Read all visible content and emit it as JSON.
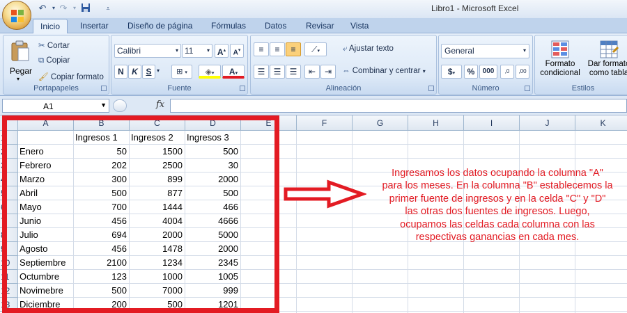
{
  "window": {
    "title": "Libro1 - Microsoft Excel"
  },
  "quick_access": {
    "undo_icon": "undo-icon",
    "redo_icon": "redo-icon",
    "save_icon": "save-icon"
  },
  "tabs": [
    "Inicio",
    "Insertar",
    "Diseño de página",
    "Fórmulas",
    "Datos",
    "Revisar",
    "Vista"
  ],
  "ribbon": {
    "portapapeles": {
      "label": "Portapapeles",
      "pegar": "Pegar",
      "cortar": "Cortar",
      "copiar": "Copiar",
      "copiar_formato": "Copiar formato"
    },
    "fuente": {
      "label": "Fuente",
      "font_name": "Calibri",
      "font_size": "11",
      "bold": "N",
      "italic": "K",
      "underline": "S"
    },
    "alineacion": {
      "label": "Alineación",
      "ajustar_texto": "Ajustar texto",
      "combinar": "Combinar y centrar"
    },
    "numero": {
      "label": "Número",
      "format": "General",
      "currency": "$",
      "percent": "%",
      "thousands": "000"
    },
    "estilos": {
      "label": "Estilos",
      "formato_condicional_1": "Formato",
      "formato_condicional_2": "condicional",
      "dar_formato_1": "Dar formato",
      "dar_formato_2": "como tabla"
    }
  },
  "formula_bar": {
    "name_box": "A1",
    "fx": "fx",
    "formula": ""
  },
  "sheet": {
    "columns": [
      "A",
      "B",
      "C",
      "D",
      "E",
      "F",
      "G",
      "H",
      "I",
      "J",
      "K"
    ],
    "row_numbers": [
      "1",
      "2",
      "3",
      "4",
      "5",
      "6",
      "7",
      "8",
      "9",
      "10",
      "11",
      "12",
      "13"
    ],
    "headers": [
      "",
      "Ingresos 1",
      "Ingresos 2",
      "Ingresos 3"
    ],
    "rows": [
      [
        "Enero",
        "50",
        "1500",
        "500"
      ],
      [
        "Febrero",
        "202",
        "2500",
        "30"
      ],
      [
        "Marzo",
        "300",
        "899",
        "2000"
      ],
      [
        "Abril",
        "500",
        "877",
        "500"
      ],
      [
        "Mayo",
        "700",
        "1444",
        "466"
      ],
      [
        "Junio",
        "456",
        "4004",
        "4666"
      ],
      [
        "Julio",
        "694",
        "2000",
        "5000"
      ],
      [
        "Agosto",
        "456",
        "1478",
        "2000"
      ],
      [
        "Septiembre",
        "2100",
        "1234",
        "2345"
      ],
      [
        "Octumbre",
        "123",
        "1000",
        "1005"
      ],
      [
        "Novimebre",
        "500",
        "7000",
        "999"
      ],
      [
        "Diciembre",
        "200",
        "500",
        "1201"
      ]
    ]
  },
  "annotation": "Ingresamos los datos ocupando la columna \"A\" para los meses. En la columna \"B\" establecemos la primer fuente de ingresos y en la celda \"C\" y \"D\" las otras dos fuentes de ingresos. Luego, ocupamos las celdas cada columna con las respectivas ganancias en cada mes.",
  "colors": {
    "highlight": "#e31b23",
    "ribbon": "#dbe7f5"
  }
}
